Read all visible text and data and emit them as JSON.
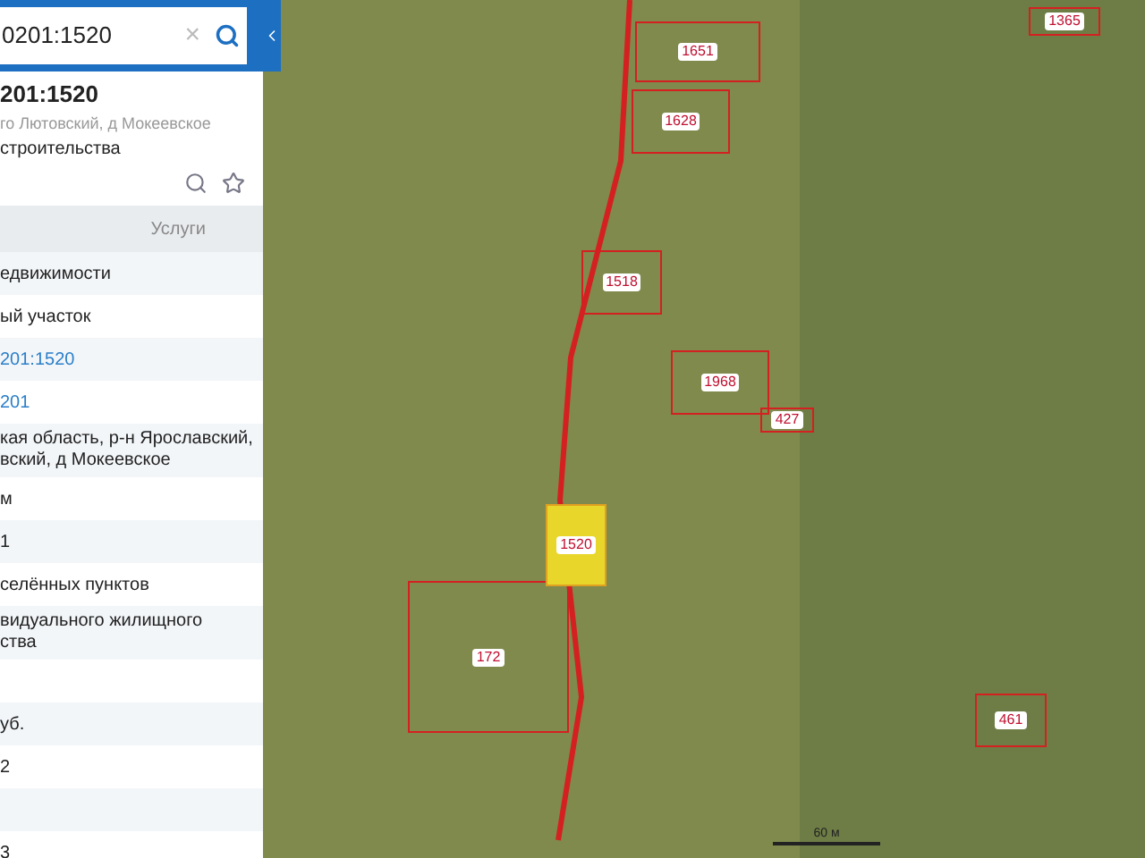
{
  "search": {
    "value": "0201:1520",
    "clear": "×"
  },
  "object": {
    "title": "201:1520",
    "address": "го Лютовский, д Мокеевское",
    "purpose": "строительства"
  },
  "tabs": [
    {
      "label": "Услуги",
      "selected": false
    }
  ],
  "rows": [
    {
      "text": "едвижимости",
      "kind": "plain"
    },
    {
      "text": "ый участок",
      "kind": "plain"
    },
    {
      "text": "201:1520",
      "kind": "link"
    },
    {
      "text": "201",
      "kind": "link"
    },
    {
      "text": "кая область, р-н Ярославский,\nвский, д Мокеевское",
      "kind": "plain"
    },
    {
      "text": "м",
      "kind": "plain"
    },
    {
      "text": "1",
      "kind": "plain"
    },
    {
      "text": "селённых пунктов",
      "kind": "plain"
    },
    {
      "text": "видуального жилищного\nства",
      "kind": "plain"
    },
    {
      "kind": "blank"
    },
    {
      "text": "уб.",
      "kind": "plain"
    },
    {
      "text": "2",
      "kind": "plain"
    },
    {
      "kind": "blank"
    },
    {
      "text": "3",
      "kind": "plain"
    }
  ],
  "map": {
    "parcels": [
      {
        "label": "1651",
        "selected": false
      },
      {
        "label": "1628",
        "selected": false
      },
      {
        "label": "1518",
        "selected": false
      },
      {
        "label": "1968",
        "selected": false
      },
      {
        "label": "427",
        "selected": false
      },
      {
        "label": "172",
        "selected": false
      },
      {
        "label": "1520",
        "selected": true
      },
      {
        "label": "461",
        "selected": false
      },
      {
        "label": "1365",
        "selected": false
      }
    ],
    "scale": "60 м"
  }
}
